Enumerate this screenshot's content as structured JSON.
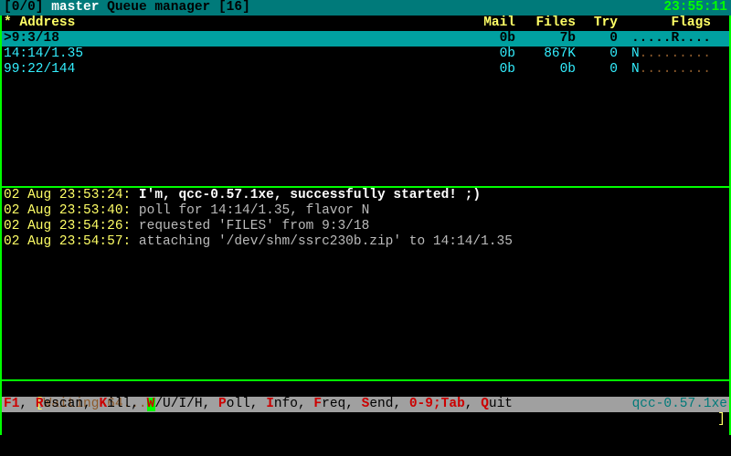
{
  "title": {
    "pos": "[0/0]",
    "name": "master",
    "label": "Queue manager",
    "count": "[16]"
  },
  "clock": "23:55:11",
  "columns": {
    "addr": "* Address",
    "mail": "Mail",
    "files": "Files",
    "try": "Try",
    "flags": "Flags"
  },
  "rows": [
    {
      "addr": ">9:3/18",
      "mail": "0b",
      "files": "7b",
      "try": "0",
      "flags": ".....R....",
      "selected": true
    },
    {
      "addr": " 14:14/1.35",
      "mail": "0b",
      "files": "867K",
      "try": "0",
      "flags": "N.........",
      "selected": false
    },
    {
      "addr": " 99:22/144",
      "mail": "0b",
      "files": "0b",
      "try": "0",
      "flags": "N.........",
      "selected": false
    }
  ],
  "log": [
    {
      "ts": "02 Aug 23:53:24:",
      "msg": " I'm, qcc-0.57.1xe, successfully started! ;)",
      "bold": true
    },
    {
      "ts": "02 Aug 23:53:40:",
      "msg": " poll for 14:14/1.35, flavor N"
    },
    {
      "ts": "02 Aug 23:54:26:",
      "msg": " requested 'FILES' from 9:3/18"
    },
    {
      "ts": "02 Aug 23:54:57:",
      "msg": " attaching '/dev/shm/ssrc230b.zip' to 14:14/1.35"
    }
  ],
  "waiting_prefix": "[",
  "waiting_text": "Waiting 64...",
  "waiting_tail": "]",
  "footer_keys": [
    {
      "hot": "F1",
      "rest": ", "
    },
    {
      "hot": "R",
      "rest": "escan, "
    },
    {
      "hot": "K",
      "rest": "ill, "
    },
    {
      "hot": "W",
      "rest": "/U/I/H, "
    },
    {
      "hot": "P",
      "rest": "oll, "
    },
    {
      "hot": "I",
      "rest": "nfo, "
    },
    {
      "hot": "F",
      "rest": "req, "
    },
    {
      "hot": "S",
      "rest": "end, "
    },
    {
      "hot": "0-9;Tab",
      "rest": ", "
    },
    {
      "hot": "Q",
      "rest": "uit"
    }
  ],
  "brand": "qcc-0.57.1xe"
}
